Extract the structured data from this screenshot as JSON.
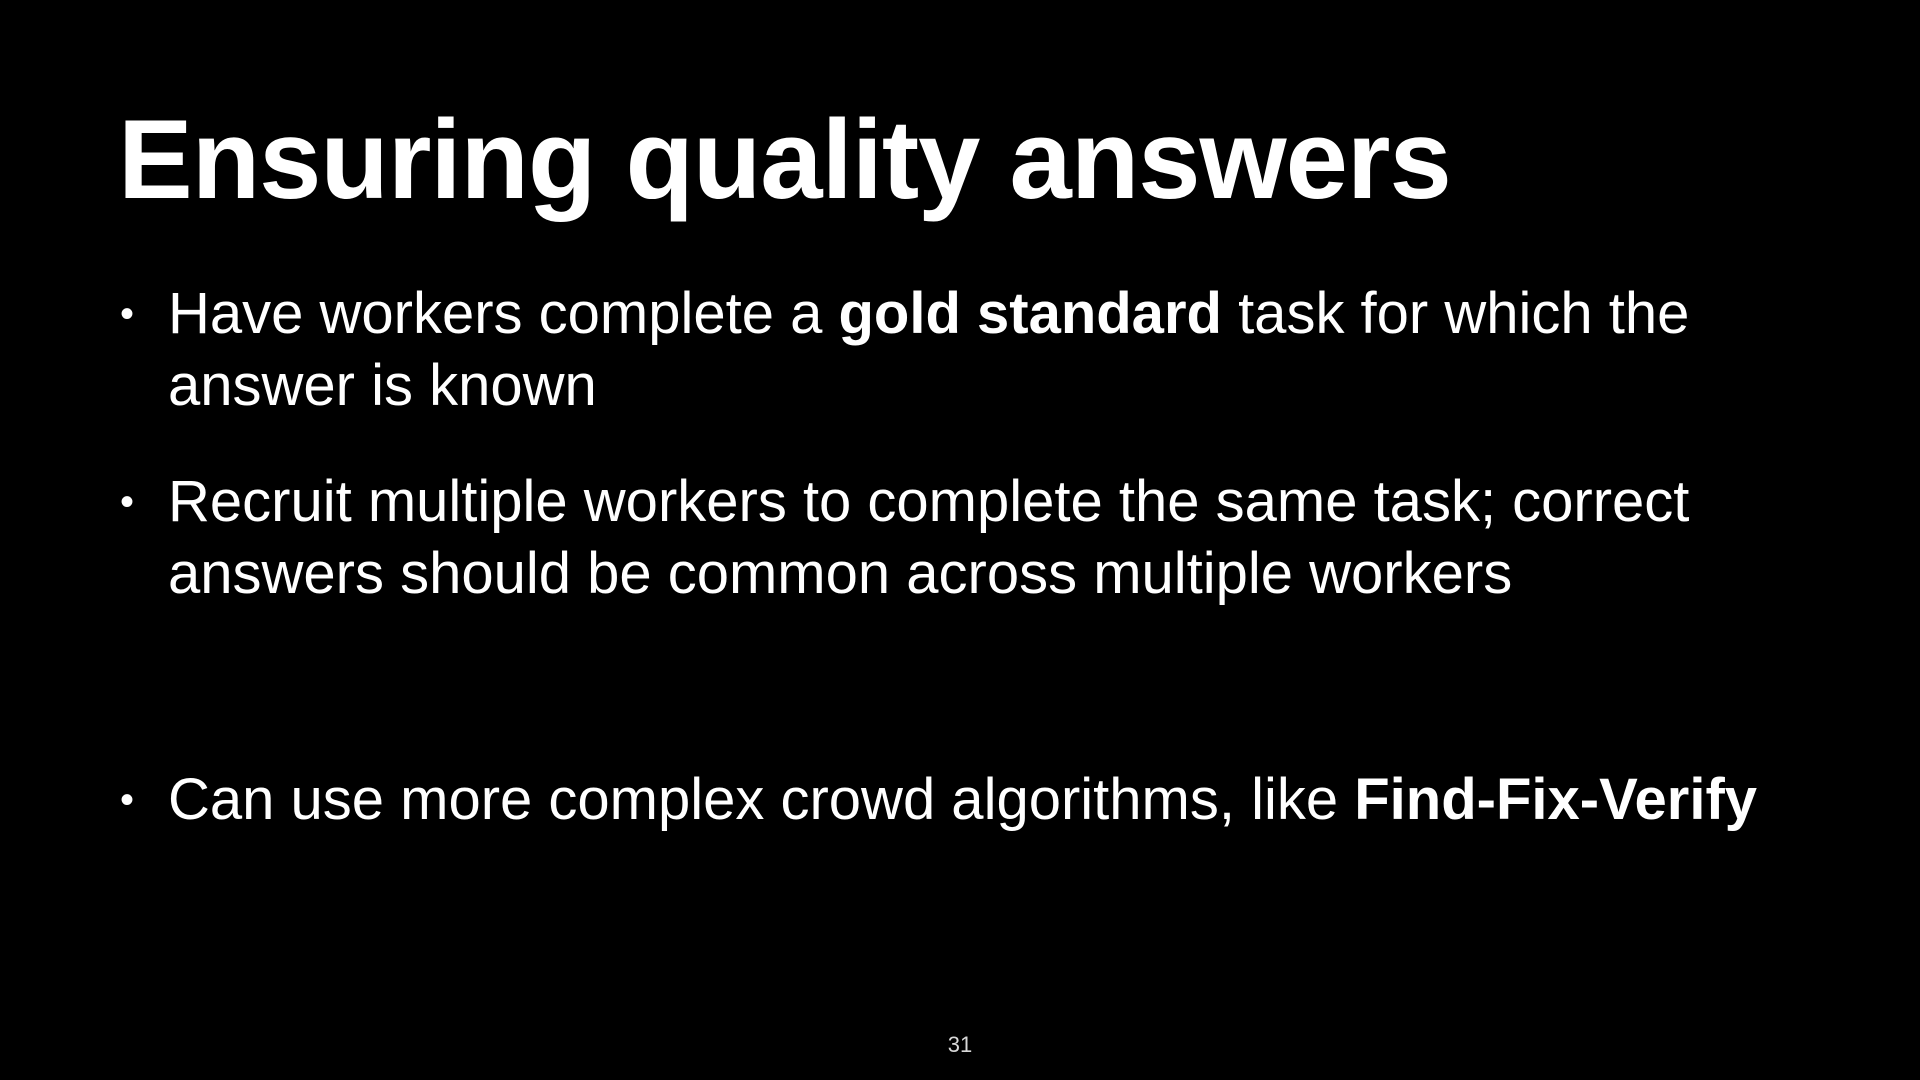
{
  "slide": {
    "title": "Ensuring quality answers",
    "bullet_marker": "•",
    "bullets": [
      {
        "part1": "Have workers complete a ",
        "bold": "gold standard",
        "part2": " task for which the answer is known"
      },
      {
        "part1": "Recruit multiple workers to complete the same task; correct answers should be common across multiple workers",
        "bold": "",
        "part2": ""
      },
      {
        "part1": "Can use more complex crowd algorithms, like ",
        "bold": "Find-Fix-Verify",
        "part2": ""
      }
    ],
    "page_number": "31"
  }
}
